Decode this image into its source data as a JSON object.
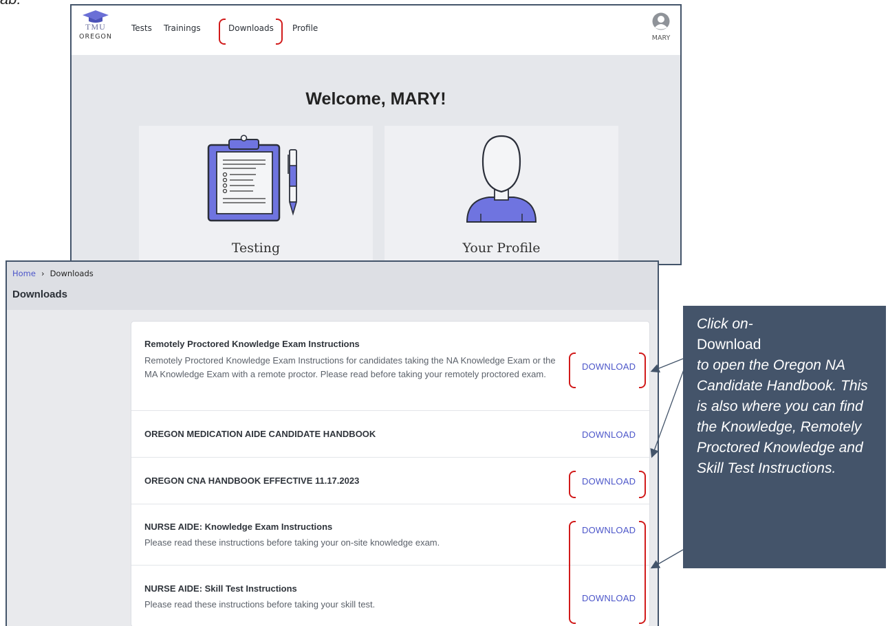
{
  "page": {
    "top_cut_text": "ab:"
  },
  "dashboard": {
    "logo": {
      "name": "TMU",
      "state": "OREGON"
    },
    "nav": [
      "Tests",
      "Trainings",
      "Downloads",
      "Profile"
    ],
    "user": {
      "name": "MARY"
    },
    "welcome": "Welcome, MARY!",
    "cards": [
      {
        "label": "Testing",
        "icon": "clipboard-icon"
      },
      {
        "label": "Your Profile",
        "icon": "person-icon"
      }
    ]
  },
  "downloads_page": {
    "breadcrumb": {
      "home": "Home",
      "current": "Downloads"
    },
    "title": "Downloads",
    "button_label": "DOWNLOAD",
    "items": [
      {
        "title": "Remotely Proctored Knowledge Exam Instructions",
        "desc": "Remotely Proctored Knowledge Exam Instructions for candidates taking the NA Knowledge Exam or the MA Knowledge Exam with a remote proctor. Please read before taking your remotely proctored exam."
      },
      {
        "title": "OREGON MEDICATION AIDE CANDIDATE HANDBOOK",
        "desc": ""
      },
      {
        "title": "OREGON CNA HANDBOOK EFFECTIVE 11.17.2023",
        "desc": ""
      },
      {
        "title": "NURSE AIDE: Knowledge Exam Instructions",
        "desc": "Please read these instructions before taking your on-site knowledge exam."
      },
      {
        "title": "NURSE AIDE: Skill Test Instructions",
        "desc": "Please read these instructions before taking your skill test."
      }
    ]
  },
  "callout": {
    "line1": "Click on-",
    "action": "Download",
    "body": "to open the Oregon NA Candidate Handbook.  This is also where you can find the Knowledge, Remotely Proctored Knowledge and Skill Test Instructions."
  },
  "colors": {
    "accent": "#4b55c9",
    "annotation": "#d11a1a",
    "callout_bg": "#44546a",
    "brand": "#6a6fd6"
  }
}
